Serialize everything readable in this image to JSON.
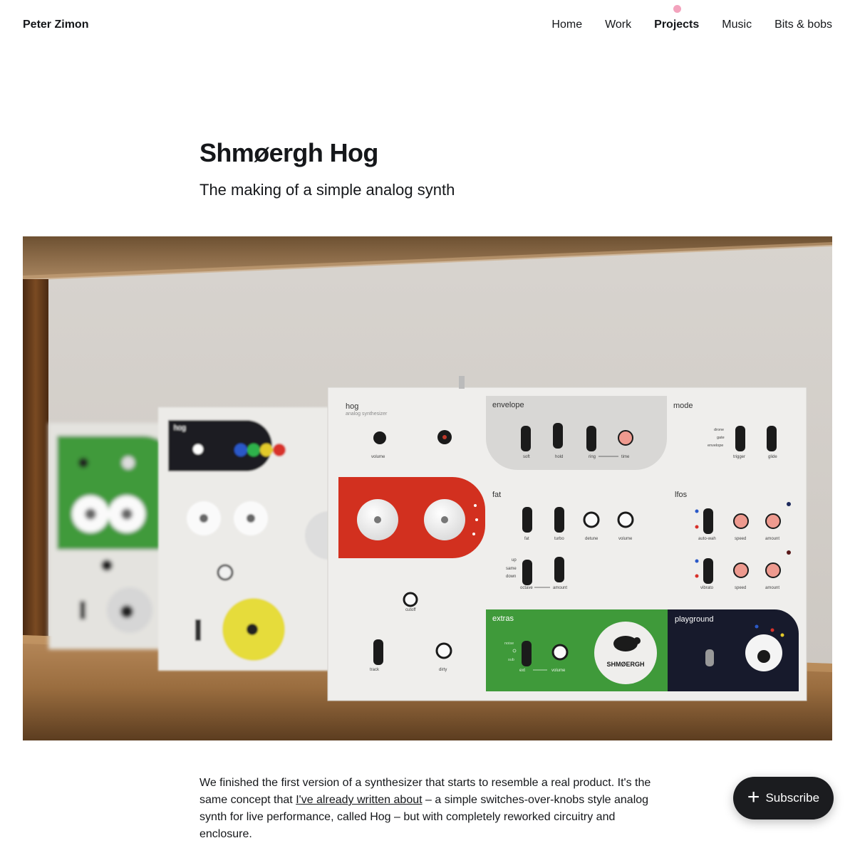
{
  "header": {
    "brand": "Peter Zimon",
    "nav": [
      {
        "label": "Home"
      },
      {
        "label": "Work"
      },
      {
        "label": "Projects",
        "active": true
      },
      {
        "label": "Music"
      },
      {
        "label": "Bits & bobs"
      }
    ],
    "active_dot_color": "#f3a3bd"
  },
  "article": {
    "title": "Shmøergh Hog",
    "subtitle": "The making of a simple analog synth",
    "body": {
      "before_link": "We finished the first version of a synthesizer that starts to resemble a real product. It's the same concept that ",
      "link": "I've already written about",
      "after_link": " – a simple switches-over-knobs style analog synth for live performance, called Hog – but with completely reworked circuitry and enclosure."
    }
  },
  "hero": {
    "main_unit": {
      "name": "hog",
      "tagline": "analog synthesizer",
      "sections": {
        "envelope": "envelope",
        "mode": "mode",
        "fat": "fat",
        "lfos": "lfos",
        "extras": "extras",
        "playground": "playground"
      },
      "labels": {
        "volume": "volume",
        "soft": "soft",
        "hold": "hold",
        "ring": "ring",
        "time": "time",
        "drone": "drone",
        "gate": "gate",
        "envelope": "envelope",
        "trigger": "trigger",
        "glide": "glide",
        "fat": "fat",
        "turbo": "turbo",
        "detune": "detune",
        "fat_volume": "volume",
        "auto_wah": "auto-wah",
        "speed1": "speed",
        "amount1": "amount",
        "up": "up",
        "same": "same",
        "down": "down",
        "octave": "octave",
        "oct_amount": "amount",
        "vibrato": "vibrato",
        "speed2": "speed",
        "amount2": "amount",
        "cutoff": "cutoff",
        "track": "track",
        "dirty": "dirty",
        "noise": "noise",
        "sub": "sub",
        "extras_volume": "volume"
      },
      "logo": "SHMØERGH"
    },
    "colors": {
      "red": "#d2301f",
      "green": "#3f9a3a",
      "navy": "#171a2c",
      "yellow": "#e6dc3a",
      "pink": "#ee9a8f"
    }
  },
  "subscribe": {
    "label": "Subscribe",
    "icon": "plus-icon"
  }
}
